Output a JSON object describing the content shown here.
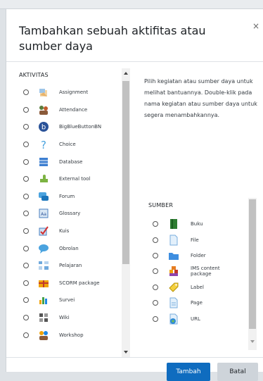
{
  "dialog": {
    "title": "Tambahkan sebuah aktifitas atau sumber daya",
    "close_glyph": "×"
  },
  "activities": {
    "header": "AKTIVITAS",
    "items": [
      {
        "label": "Assignment",
        "icon": "assignment-icon"
      },
      {
        "label": "Attendance",
        "icon": "attendance-icon"
      },
      {
        "label": "BigBlueButtonBN",
        "icon": "bigbluebutton-icon"
      },
      {
        "label": "Choice",
        "icon": "choice-icon"
      },
      {
        "label": "Database",
        "icon": "database-icon"
      },
      {
        "label": "External tool",
        "icon": "external-tool-icon"
      },
      {
        "label": "Forum",
        "icon": "forum-icon"
      },
      {
        "label": "Glossary",
        "icon": "glossary-icon"
      },
      {
        "label": "Kuis",
        "icon": "quiz-icon"
      },
      {
        "label": "Obrolan",
        "icon": "chat-icon"
      },
      {
        "label": "Pelajaran",
        "icon": "lesson-icon"
      },
      {
        "label": "SCORM package",
        "icon": "scorm-icon"
      },
      {
        "label": "Survei",
        "icon": "survey-icon"
      },
      {
        "label": "Wiki",
        "icon": "wiki-icon"
      },
      {
        "label": "Workshop",
        "icon": "workshop-icon"
      }
    ]
  },
  "help_text": "Pilih kegiatan atau sumber daya untuk melihat bantuannya. Double-klik pada nama kegiatan atau sumber daya untuk segera menambahkannya.",
  "resources": {
    "header": "SUMBER",
    "items": [
      {
        "label": "Buku",
        "icon": "book-icon"
      },
      {
        "label": "File",
        "icon": "file-icon"
      },
      {
        "label": "Folder",
        "icon": "folder-icon"
      },
      {
        "label": "IMS content package",
        "icon": "ims-package-icon"
      },
      {
        "label": "Label",
        "icon": "label-icon"
      },
      {
        "label": "Page",
        "icon": "page-icon"
      },
      {
        "label": "URL",
        "icon": "url-icon"
      }
    ]
  },
  "buttons": {
    "add": "Tambah",
    "cancel": "Batal"
  },
  "colors": {
    "primary": "#0f6cbf",
    "secondary": "#ced4da"
  }
}
